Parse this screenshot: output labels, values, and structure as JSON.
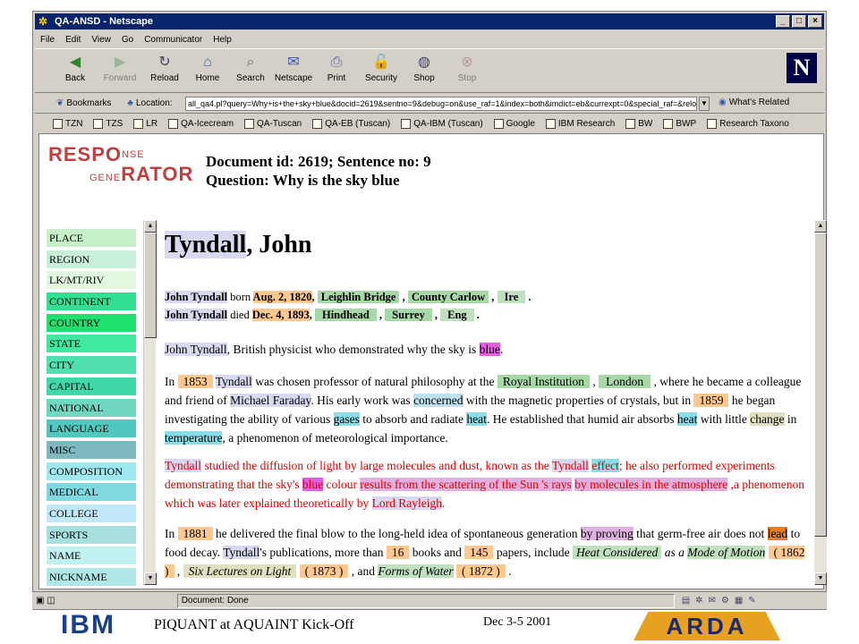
{
  "window": {
    "title": "QA-ANSD - Netscape"
  },
  "menu": [
    "File",
    "Edit",
    "View",
    "Go",
    "Communicator",
    "Help"
  ],
  "toolbar": [
    {
      "label": "Back",
      "icon": "back-arrow-icon",
      "disabled": false
    },
    {
      "label": "Forward",
      "icon": "forward-arrow-icon",
      "disabled": true
    },
    {
      "label": "Reload",
      "icon": "reload-icon",
      "disabled": false
    },
    {
      "label": "Home",
      "icon": "home-icon",
      "disabled": false
    },
    {
      "label": "Search",
      "icon": "search-icon",
      "disabled": false
    },
    {
      "label": "Netscape",
      "icon": "netscape-icon",
      "disabled": false
    },
    {
      "label": "Print",
      "icon": "print-icon",
      "disabled": false
    },
    {
      "label": "Security",
      "icon": "lock-icon",
      "disabled": false
    },
    {
      "label": "Shop",
      "icon": "shop-icon",
      "disabled": false
    },
    {
      "label": "Stop",
      "icon": "stop-icon",
      "disabled": true
    }
  ],
  "location": {
    "bookmarks_label": "Bookmarks",
    "location_label": "Location:",
    "url": "all_qa4.pl?query=Why+is+the+sky+blue&docid=2619&sentno=9&debug=on&use_raf=1&index=both&imdict=eb&currexpt=0&special_raf=&relopt=",
    "whats_related": "What's Related"
  },
  "personal_toolbar": [
    "TZN",
    "TZS",
    "LR",
    "QA-Icecream",
    "QA-Tuscan",
    "QA-EB (Tuscan)",
    "QA-IBM (Tuscan)",
    "Google",
    "IBM Research",
    "BW",
    "BWP",
    "Research Taxono"
  ],
  "logo": {
    "line1": "RESPO",
    "nse": "NSE",
    "gene": "GENE",
    "line2": "RATOR"
  },
  "doc": {
    "header1": "Document id: 2619; Sentence no: 9",
    "header2": "Question: Why is the sky blue"
  },
  "sidebar": [
    {
      "label": "PLACE",
      "color": "#c8f0c8"
    },
    {
      "label": "REGION",
      "color": "#c8f0d8"
    },
    {
      "label": "LK/MT/RIV",
      "color": "#e0f8e0"
    },
    {
      "label": "CONTINENT",
      "color": "#30e090"
    },
    {
      "label": "COUNTRY",
      "color": "#20e070"
    },
    {
      "label": "STATE",
      "color": "#40e8a0"
    },
    {
      "label": "CITY",
      "color": "#50e0b0"
    },
    {
      "label": "CAPITAL",
      "color": "#40d8a8"
    },
    {
      "label": "NATIONAL",
      "color": "#70d8c0"
    },
    {
      "label": "LANGUAGE",
      "color": "#50c8c0"
    },
    {
      "label": "MISC",
      "color": "#80b8c0"
    },
    {
      "label": "COMPOSITION",
      "color": "#a0e8f0"
    },
    {
      "label": "MEDICAL",
      "color": "#80d8e0"
    },
    {
      "label": "COLLEGE",
      "color": "#c0e8f8"
    },
    {
      "label": "SPORTS",
      "color": "#a8e0e0"
    },
    {
      "label": "NAME",
      "color": "#c0f0f0"
    },
    {
      "label": "NICKNAME",
      "color": "#b0e8e8"
    }
  ],
  "article": {
    "title_name": "Tyndall",
    "title_rest": ", John",
    "born": {
      "name": "John Tyndall",
      "born": "born",
      "date": "Aug. 2, 1820",
      "comma": ",",
      "p1": "Leighlin Bridge",
      "p2": "County Carlow",
      "p3": "Ire",
      "end": "."
    },
    "died": {
      "name": "John Tyndall",
      "died": "died",
      "date": "Dec. 4, 1893",
      "comma": ",",
      "p1": "Hindhead",
      "p2": "Surrey",
      "p3": "Eng",
      "end": "."
    }
  },
  "status": {
    "text": "Document: Done"
  },
  "footer": {
    "ibm": "IBM",
    "title": "PIQUANT at AQUAINT Kick-Off",
    "date": "Dec 3-5 2001",
    "arda": "ARDA"
  }
}
